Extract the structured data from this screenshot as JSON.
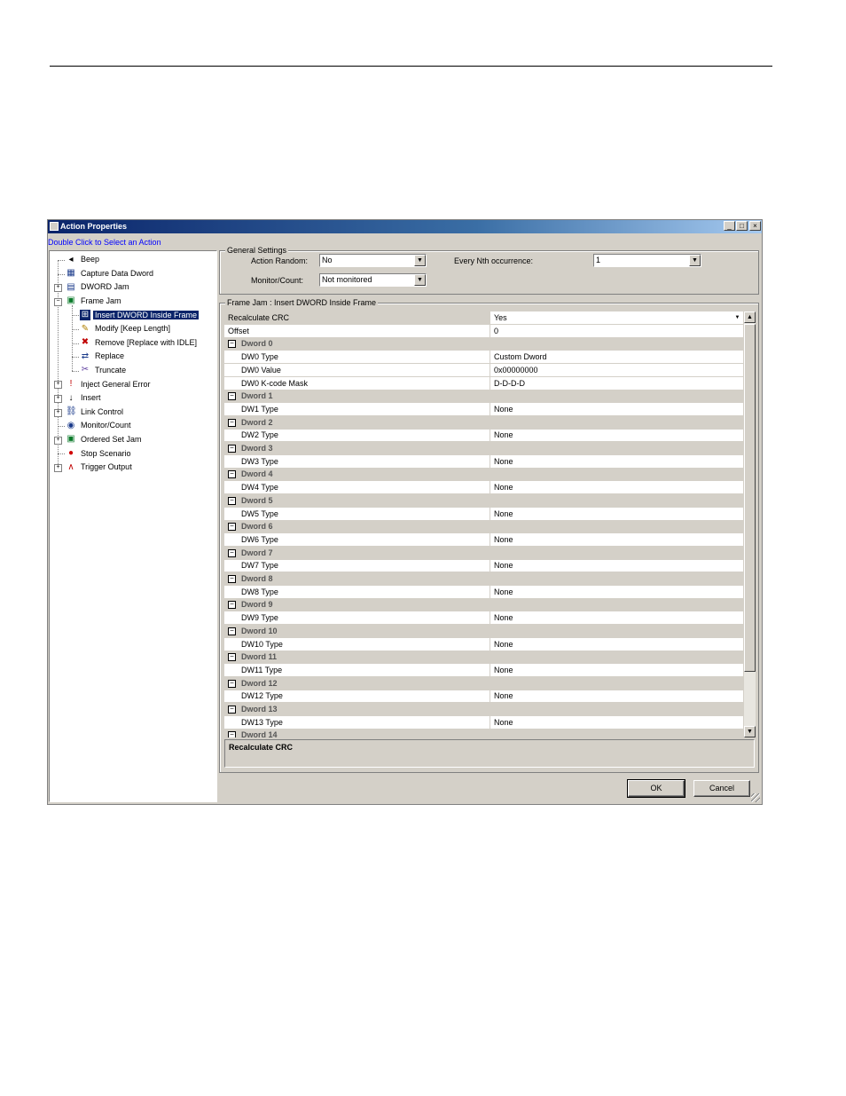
{
  "window": {
    "title": "Action Properties",
    "controls": {
      "minimize": "_",
      "maximize": "□",
      "close": "×"
    }
  },
  "hint": "Double Click to Select an Action",
  "tree": {
    "items": [
      {
        "label": "Beep",
        "icon": "speaker-icon",
        "level": 0,
        "expander": false
      },
      {
        "label": "Capture Data Dword",
        "icon": "capture-icon",
        "level": 0,
        "expander": false
      },
      {
        "label": "DWORD Jam",
        "icon": "dword-icon",
        "level": 0,
        "expander": true,
        "expanded": false
      },
      {
        "label": "Frame Jam",
        "icon": "frame-jam-icon",
        "level": 0,
        "expander": true,
        "expanded": true
      },
      {
        "label": "Insert DWORD Inside Frame",
        "icon": "insert-dword-icon",
        "level": 1,
        "selected": true
      },
      {
        "label": "Modify [Keep Length]",
        "icon": "modify-icon",
        "level": 1
      },
      {
        "label": "Remove [Replace with IDLE]",
        "icon": "remove-icon",
        "level": 1
      },
      {
        "label": "Replace",
        "icon": "replace-icon",
        "level": 1
      },
      {
        "label": "Truncate",
        "icon": "truncate-icon",
        "level": 1
      },
      {
        "label": "Inject General Error",
        "icon": "error-icon",
        "level": 0,
        "expander": true,
        "expanded": false
      },
      {
        "label": "Insert",
        "icon": "insert-icon",
        "level": 0,
        "expander": true,
        "expanded": false
      },
      {
        "label": "Link Control",
        "icon": "link-icon",
        "level": 0,
        "expander": true,
        "expanded": false
      },
      {
        "label": "Monitor/Count",
        "icon": "monitor-icon",
        "level": 0,
        "expander": false
      },
      {
        "label": "Ordered Set Jam",
        "icon": "ordered-set-icon",
        "level": 0,
        "expander": true,
        "expanded": false
      },
      {
        "label": "Stop Scenario",
        "icon": "stop-icon",
        "level": 0,
        "expander": false
      },
      {
        "label": "Trigger Output",
        "icon": "trigger-icon",
        "level": 0,
        "expander": true,
        "expanded": false
      }
    ]
  },
  "general": {
    "legend": "General Settings",
    "action_random_label": "Action Random:",
    "action_random_value": "No",
    "monitor_label": "Monitor/Count:",
    "monitor_value": "Not monitored",
    "every_nth_label": "Every Nth occurrence:",
    "every_nth_value": "1"
  },
  "framejam": {
    "legend": "Frame Jam : Insert DWORD Inside Frame",
    "rows": [
      {
        "type": "prop",
        "name": "Recalculate CRC",
        "value": "Yes",
        "selected": true
      },
      {
        "type": "prop",
        "name": "Offset",
        "value": "0"
      },
      {
        "type": "cat",
        "name": "Dword 0"
      },
      {
        "type": "prop",
        "name": "DW0 Type",
        "value": "Custom Dword",
        "indent": true
      },
      {
        "type": "prop",
        "name": "DW0 Value",
        "value": "0x00000000",
        "indent": true
      },
      {
        "type": "prop",
        "name": "DW0 K-code Mask",
        "value": "D-D-D-D",
        "indent": true
      },
      {
        "type": "cat",
        "name": "Dword 1"
      },
      {
        "type": "prop",
        "name": "DW1 Type",
        "value": "None",
        "indent": true
      },
      {
        "type": "cat",
        "name": "Dword 2"
      },
      {
        "type": "prop",
        "name": "DW2 Type",
        "value": "None",
        "indent": true
      },
      {
        "type": "cat",
        "name": "Dword 3"
      },
      {
        "type": "prop",
        "name": "DW3 Type",
        "value": "None",
        "indent": true
      },
      {
        "type": "cat",
        "name": "Dword 4"
      },
      {
        "type": "prop",
        "name": "DW4 Type",
        "value": "None",
        "indent": true
      },
      {
        "type": "cat",
        "name": "Dword 5"
      },
      {
        "type": "prop",
        "name": "DW5 Type",
        "value": "None",
        "indent": true
      },
      {
        "type": "cat",
        "name": "Dword 6"
      },
      {
        "type": "prop",
        "name": "DW6 Type",
        "value": "None",
        "indent": true
      },
      {
        "type": "cat",
        "name": "Dword 7"
      },
      {
        "type": "prop",
        "name": "DW7 Type",
        "value": "None",
        "indent": true
      },
      {
        "type": "cat",
        "name": "Dword 8"
      },
      {
        "type": "prop",
        "name": "DW8 Type",
        "value": "None",
        "indent": true
      },
      {
        "type": "cat",
        "name": "Dword 9"
      },
      {
        "type": "prop",
        "name": "DW9 Type",
        "value": "None",
        "indent": true
      },
      {
        "type": "cat",
        "name": "Dword 10"
      },
      {
        "type": "prop",
        "name": "DW10 Type",
        "value": "None",
        "indent": true
      },
      {
        "type": "cat",
        "name": "Dword 11"
      },
      {
        "type": "prop",
        "name": "DW11 Type",
        "value": "None",
        "indent": true
      },
      {
        "type": "cat",
        "name": "Dword 12"
      },
      {
        "type": "prop",
        "name": "DW12 Type",
        "value": "None",
        "indent": true
      },
      {
        "type": "cat",
        "name": "Dword 13"
      },
      {
        "type": "prop",
        "name": "DW13 Type",
        "value": "None",
        "indent": true
      },
      {
        "type": "cat",
        "name": "Dword 14"
      }
    ]
  },
  "description": {
    "title": "Recalculate CRC"
  },
  "buttons": {
    "ok": "OK",
    "cancel": "Cancel"
  }
}
